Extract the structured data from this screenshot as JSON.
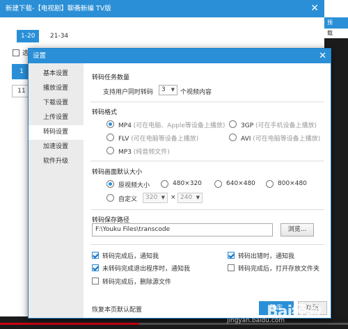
{
  "background_window": {
    "title": "新建下载-【电视剧】聊斋新编 TV版",
    "close": "✕",
    "tabs": [
      {
        "label": "1-20"
      },
      {
        "label": "21-34"
      }
    ],
    "select_all_label": "选",
    "episodes": [
      {
        "label": "1"
      },
      {
        "label": "11"
      }
    ],
    "right_button": "预",
    "right_button2": "载"
  },
  "dialog": {
    "title": "设置",
    "close": "✕",
    "sidebar": [
      {
        "label": "基本设置"
      },
      {
        "label": "播放设置"
      },
      {
        "label": "下载设置"
      },
      {
        "label": "上传设置"
      },
      {
        "label": "转码设置"
      },
      {
        "label": "加速设置"
      },
      {
        "label": "软件升级"
      }
    ],
    "active_sidebar_index": 4,
    "task_count": {
      "heading": "转码任务数量",
      "prefix": "支持用户同时转码",
      "value": "3",
      "suffix": "个视频内容"
    },
    "format": {
      "heading": "转码格式",
      "options": [
        {
          "name": "MP4",
          "hint": "(可在电脑、Apple等设备上播放)",
          "selected": true
        },
        {
          "name": "3GP",
          "hint": "(可在手机设备上播放)",
          "selected": false
        },
        {
          "name": "FLV",
          "hint": "(可在电脑等设备上播放)",
          "selected": false
        },
        {
          "name": "AVI",
          "hint": "(可在电脑等设备上播放)",
          "selected": false
        },
        {
          "name": "MP3",
          "hint": "(纯音频文件)",
          "selected": false
        }
      ]
    },
    "size": {
      "heading": "转码画面默认大小",
      "options": [
        {
          "name": "原视频大小",
          "selected": true
        },
        {
          "name": "480×320",
          "selected": false
        },
        {
          "name": "640×480",
          "selected": false
        },
        {
          "name": "800×480",
          "selected": false
        }
      ],
      "custom_label": "自定义",
      "custom_width": "320",
      "custom_height": "240",
      "times": "×"
    },
    "save_path": {
      "heading": "转码保存路径",
      "value": "F:\\Youku Files\\transcode",
      "browse": "浏览..."
    },
    "notifications": [
      {
        "label": "转码完成后，通知我",
        "checked": true
      },
      {
        "label": "转码出错时，通知我",
        "checked": true
      },
      {
        "label": "未转码完成退出程序时，通知我",
        "checked": true
      },
      {
        "label": "转码完成后，打开存放文件夹",
        "checked": false
      },
      {
        "label": "转码完成后，删除源文件",
        "checked": false
      }
    ],
    "reset_label": "恢复本页默认配置",
    "confirm_label": "确定",
    "cancel_label": "取消"
  },
  "watermark": {
    "text": "Bai经验",
    "sub": "jingyan.baidu.com"
  },
  "colors": {
    "accent": "#2a8fd6",
    "sidebar_bg": "#ebebeb",
    "hint": "#999999"
  }
}
